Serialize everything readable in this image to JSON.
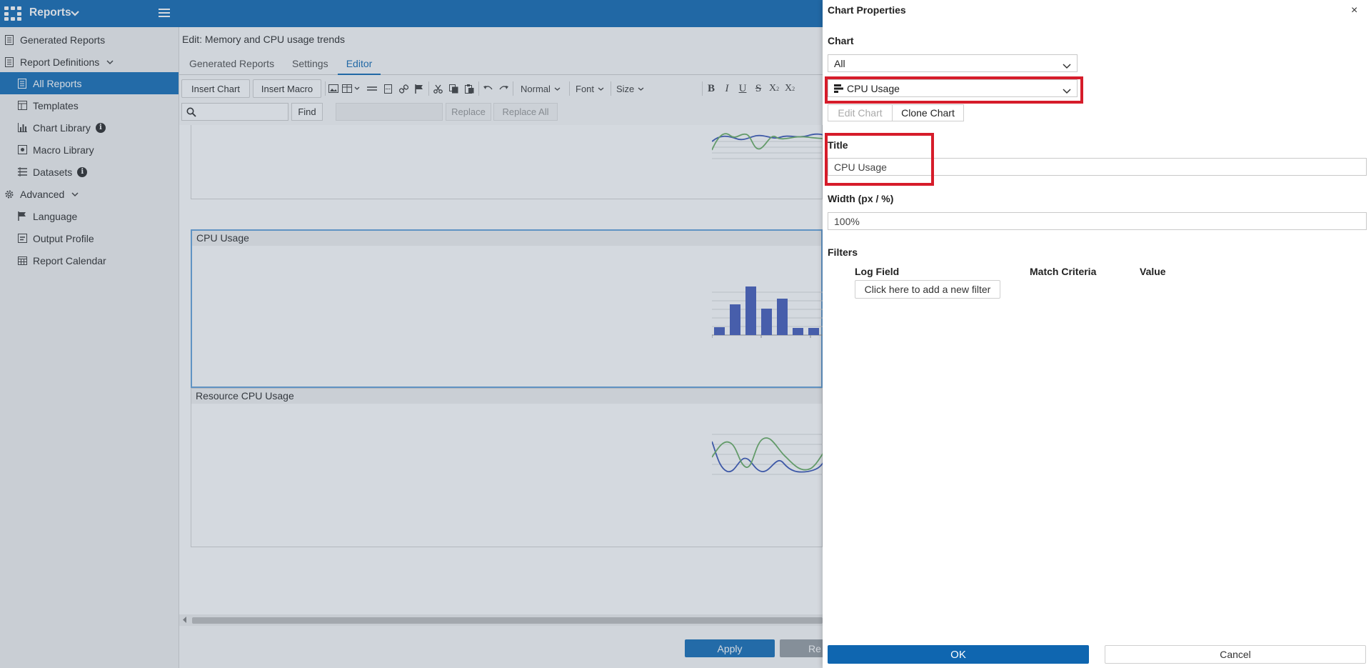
{
  "app": {
    "title": "Reports",
    "icons": {
      "apps": "apps-grid-icon",
      "menu": "hamburger-menu-icon"
    },
    "colors": {
      "brand": "#1a6fb5",
      "active": "#1d73b9",
      "highlight": "#d61c2a"
    }
  },
  "sidebar": {
    "items": [
      {
        "label": "Generated Reports",
        "icon": "report-icon"
      },
      {
        "label": "Report Definitions",
        "icon": "report-icon",
        "expandable": true
      },
      {
        "label": "All Reports",
        "icon": "report-icon",
        "active": true
      },
      {
        "label": "Templates",
        "icon": "template-icon"
      },
      {
        "label": "Chart Library",
        "icon": "bar-chart-icon",
        "info": "i"
      },
      {
        "label": "Macro Library",
        "icon": "macro-icon"
      },
      {
        "label": "Datasets",
        "icon": "dataset-icon",
        "info": "i"
      },
      {
        "label": "Advanced",
        "icon": "gear-icon",
        "expandable": true
      },
      {
        "label": "Language",
        "icon": "flag-icon"
      },
      {
        "label": "Output Profile",
        "icon": "output-icon"
      },
      {
        "label": "Report Calendar",
        "icon": "calendar-icon"
      }
    ]
  },
  "editor": {
    "heading": "Edit: Memory and CPU usage trends",
    "tabs": [
      "Generated Reports",
      "Settings",
      "Editor"
    ],
    "active_tab": "Editor",
    "toolbar": {
      "insert_chart": "Insert Chart",
      "insert_macro": "Insert Macro",
      "format": "Normal",
      "font": "Font",
      "size": "Size"
    },
    "findbar": {
      "find": "Find",
      "replace": "Replace",
      "replace_all": "Replace All"
    },
    "blocks": [
      {
        "title": ""
      },
      {
        "title": "CPU Usage"
      },
      {
        "title": "Resource CPU Usage"
      }
    ],
    "apply": "Apply",
    "reset_partial": "Re"
  },
  "panel": {
    "title": "Chart Properties",
    "close": "×",
    "chart_label": "Chart",
    "chart_category": "All",
    "chart_selected": "CPU Usage",
    "edit_chart": "Edit Chart",
    "clone_chart": "Clone Chart",
    "title_label": "Title",
    "title_value": "CPU Usage",
    "width_label": "Width (px / %)",
    "width_value": "100%",
    "filters_label": "Filters",
    "filter_columns": [
      "Log Field",
      "Match Criteria",
      "Value"
    ],
    "add_filter": "Click here to add a new filter",
    "ok": "OK",
    "cancel": "Cancel"
  }
}
